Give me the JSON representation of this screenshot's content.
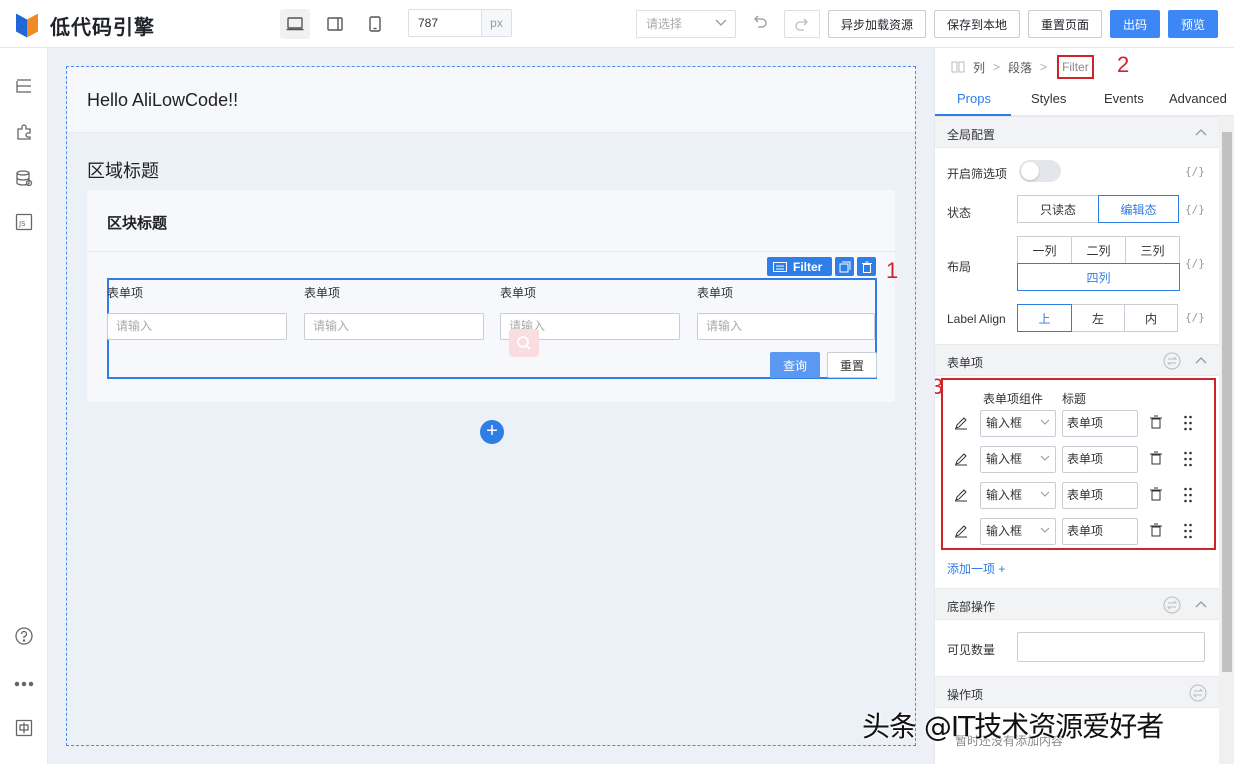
{
  "app": {
    "logo_text": "低代码引擎"
  },
  "toolbar": {
    "width_value": "787",
    "width_unit": "px",
    "select_placeholder": "请选择",
    "async_load": "异步加载资源",
    "save_local": "保存到本地",
    "reset_page": "重置页面",
    "export": "出码",
    "preview": "预览"
  },
  "canvas": {
    "page_header": "Hello AliLowCode!!",
    "area_title": "区域标题",
    "block_title": "区块标题",
    "selection_tag": "Filter",
    "filter_items": [
      {
        "label": "表单项",
        "placeholder": "请输入"
      },
      {
        "label": "表单项",
        "placeholder": "请输入"
      },
      {
        "label": "表单项",
        "placeholder": "请输入"
      },
      {
        "label": "表单项",
        "placeholder": "请输入"
      }
    ],
    "query_button": "查询",
    "reset_button": "重置",
    "annotation_1": "1"
  },
  "panel": {
    "breadcrumbs": [
      "列",
      "段落",
      "Filter"
    ],
    "annotation_2": "2",
    "annotation_3": "3",
    "tabs": [
      "Props",
      "Styles",
      "Events",
      "Advanced"
    ],
    "active_tab": "Props",
    "global_config": {
      "title": "全局配置",
      "enable_filter": "开启筛选项",
      "status_label": "状态",
      "status_options": [
        "只读态",
        "编辑态"
      ],
      "status_value": "编辑态",
      "layout_label": "布局",
      "layout_options": [
        "一列",
        "二列",
        "三列",
        "四列"
      ],
      "layout_value": "四列",
      "label_align_label": "Label Align",
      "label_align_options": [
        "上",
        "左",
        "内"
      ],
      "label_align_value": "上",
      "var_binding": "{/}"
    },
    "form_items": {
      "title": "表单项",
      "col_component": "表单项组件",
      "col_title": "标题",
      "rows": [
        {
          "component": "输入框",
          "title": "表单项"
        },
        {
          "component": "输入框",
          "title": "表单项"
        },
        {
          "component": "输入框",
          "title": "表单项"
        },
        {
          "component": "输入框",
          "title": "表单项"
        }
      ],
      "add_item": "添加一项 +"
    },
    "bottom_actions": {
      "title": "底部操作",
      "visible_count_label": "可见数量"
    },
    "actions": {
      "title": "操作项"
    },
    "hint": "暂时还没有添加内容"
  },
  "watermark": "头条 @IT技术资源爱好者"
}
